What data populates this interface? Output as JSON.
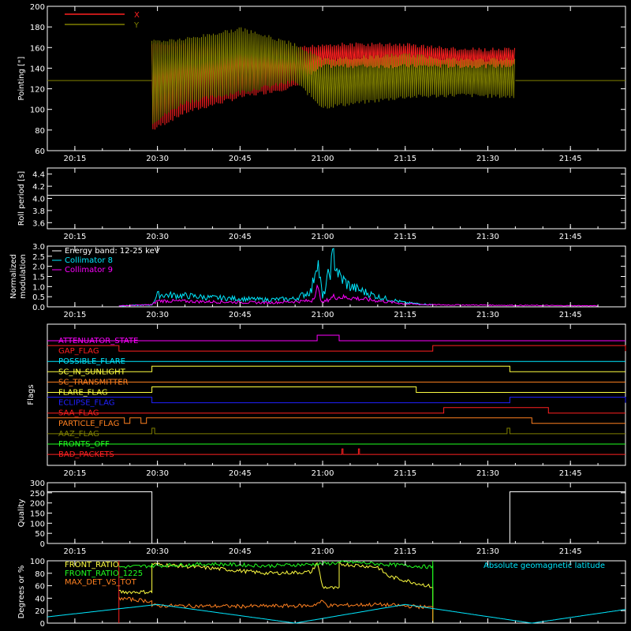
{
  "colors": {
    "background": "#000000",
    "axis": "#ffffff",
    "red": "#ff2020",
    "olive": "#808000",
    "cyan": "#00e8ff",
    "magenta": "#ff00ff",
    "yellow": "#ffff40",
    "green": "#20ff20",
    "orange": "#ff8020",
    "blue": "#2020ff",
    "bright_red": "#ff2020"
  },
  "x_ticks": [
    "20:15",
    "20:30",
    "20:45",
    "21:00",
    "21:15",
    "21:30",
    "21:45"
  ],
  "chart_data": [
    {
      "type": "line",
      "panel": "pointing",
      "title": "",
      "ylabel": "Pointing [\"]",
      "xlim": [
        "20:10",
        "21:55"
      ],
      "ylim": [
        60,
        200
      ],
      "yticks": [
        "60",
        "80",
        "100",
        "120",
        "140",
        "160",
        "180",
        "200"
      ],
      "legend_placement": "top-left",
      "series": [
        {
          "name": "X",
          "color": "#ff2020",
          "envelope": [
            {
              "t": "20:29",
              "low": 78,
              "high": 165
            },
            {
              "t": "20:35",
              "low": 95,
              "high": 165
            },
            {
              "t": "20:45",
              "low": 110,
              "high": 165
            },
            {
              "t": "20:55",
              "low": 120,
              "high": 160
            },
            {
              "t": "21:00",
              "low": 140,
              "high": 165
            },
            {
              "t": "21:15",
              "low": 140,
              "high": 165
            },
            {
              "t": "21:25",
              "low": 140,
              "high": 160
            },
            {
              "t": "21:35",
              "low": 140,
              "high": 160
            }
          ]
        },
        {
          "name": "Y",
          "color": "#808000",
          "baseline": 128,
          "envelope": [
            {
              "t": "20:29",
              "low": 85,
              "high": 168
            },
            {
              "t": "20:35",
              "low": 105,
              "high": 170
            },
            {
              "t": "20:45",
              "low": 115,
              "high": 180
            },
            {
              "t": "20:55",
              "low": 125,
              "high": 165
            },
            {
              "t": "21:00",
              "low": 100,
              "high": 150
            },
            {
              "t": "21:15",
              "low": 110,
              "high": 155
            },
            {
              "t": "21:25",
              "low": 112,
              "high": 150
            },
            {
              "t": "21:35",
              "low": 110,
              "high": 150
            }
          ]
        }
      ]
    },
    {
      "type": "line",
      "panel": "roll",
      "ylabel": "Roll period [s]",
      "xlim": [
        "20:10",
        "21:55"
      ],
      "ylim": [
        3.5,
        4.5
      ],
      "yticks": [
        "3.6",
        "3.8",
        "4.0",
        "4.2",
        "4.4"
      ],
      "series": [
        {
          "color": "#ffffff",
          "value": 4.05
        }
      ]
    },
    {
      "type": "line",
      "panel": "modulation",
      "ylabel": "Normalized modulation",
      "ylabel_lines": [
        "Normalized",
        "modulation"
      ],
      "xlim": [
        "20:10",
        "21:55"
      ],
      "ylim": [
        0,
        3
      ],
      "yticks": [
        "0.0",
        "0.5",
        "1.0",
        "1.5",
        "2.0",
        "2.5",
        "3.0"
      ],
      "legend_placement": "top-left",
      "legend_title": "Energy band: 12-25 keV",
      "series": [
        {
          "name": "Collimator 8",
          "color": "#00e8ff",
          "points": [
            [
              "20:23",
              0.05
            ],
            [
              "20:29",
              0.1
            ],
            [
              "20:30",
              0.6
            ],
            [
              "20:35",
              0.55
            ],
            [
              "20:40",
              0.45
            ],
            [
              "20:45",
              0.4
            ],
            [
              "20:50",
              0.35
            ],
            [
              "20:55",
              0.4
            ],
            [
              "20:58",
              0.8
            ],
            [
              "20:59",
              2.5
            ],
            [
              "21:00",
              0.4
            ],
            [
              "21:02",
              2.5
            ],
            [
              "21:03",
              1.5
            ],
            [
              "21:05",
              1.0
            ],
            [
              "21:10",
              0.5
            ],
            [
              "21:15",
              0.2
            ],
            [
              "21:20",
              0.1
            ]
          ]
        },
        {
          "name": "Collimator 9",
          "color": "#ff00ff",
          "points": [
            [
              "20:23",
              0.05
            ],
            [
              "20:29",
              0.1
            ],
            [
              "20:30",
              0.3
            ],
            [
              "20:40",
              0.25
            ],
            [
              "20:50",
              0.2
            ],
            [
              "20:58",
              0.3
            ],
            [
              "20:59",
              0.9
            ],
            [
              "21:00",
              0.2
            ],
            [
              "21:02",
              0.5
            ],
            [
              "21:05",
              0.45
            ],
            [
              "21:10",
              0.3
            ],
            [
              "21:15",
              0.15
            ],
            [
              "21:20",
              0.1
            ],
            [
              "21:50",
              0.05
            ]
          ]
        }
      ]
    },
    {
      "type": "line",
      "panel": "flags",
      "ylabel": "Flags",
      "xlim": [
        "20:10",
        "21:55"
      ],
      "flags": [
        {
          "name": "ATTENUATOR_STATE",
          "color": "#ff00ff",
          "on": [
            [
              "20:59",
              "21:03"
            ]
          ]
        },
        {
          "name": "GAP_FLAG",
          "color": "#ff2020",
          "on": [
            [
              "20:10",
              "20:23"
            ],
            [
              "21:20",
              "21:55"
            ]
          ]
        },
        {
          "name": "POSSIBLE_FLARE",
          "color": "#00e8ff",
          "on": []
        },
        {
          "name": "SC_IN_SUNLIGHT",
          "color": "#ffff40",
          "on": [
            [
              "20:29",
              "21:34"
            ]
          ]
        },
        {
          "name": "SC_TRANSMITTER",
          "color": "#ff8020",
          "on": []
        },
        {
          "name": "FLARE_FLAG",
          "color": "#ffff40",
          "on": [
            [
              "20:29",
              "21:17"
            ]
          ]
        },
        {
          "name": "ECLIPSE_FLAG",
          "color": "#2020ff",
          "on": [
            [
              "20:10",
              "20:29"
            ],
            [
              "21:34",
              "21:55"
            ]
          ]
        },
        {
          "name": "SAA_FLAG",
          "color": "#ff2020",
          "on": [
            [
              "21:22",
              "21:41"
            ]
          ]
        },
        {
          "name": "PARTICLE_FLAG",
          "color": "#ff8020",
          "on": [
            [
              "20:10",
              "20:24"
            ],
            [
              "20:25",
              "20:27"
            ],
            [
              "20:28",
              "21:38"
            ]
          ]
        },
        {
          "name": "AAZ_FLAG",
          "color": "#808000",
          "on": [
            [
              "20:29",
              "20:29.5"
            ],
            [
              "21:33.5",
              "21:34"
            ]
          ]
        },
        {
          "name": "FRONTS_OFF",
          "color": "#20ff20",
          "on": []
        },
        {
          "name": "BAD_PACKETS",
          "color": "#ff2020",
          "on": [
            [
              "21:03.5",
              "21:03.7"
            ],
            [
              "21:06.5",
              "21:06.7"
            ]
          ]
        }
      ]
    },
    {
      "type": "line",
      "panel": "quality",
      "ylabel": "Quality",
      "xlim": [
        "20:10",
        "21:55"
      ],
      "ylim": [
        0,
        300
      ],
      "yticks": [
        "0",
        "50",
        "100",
        "150",
        "200",
        "250",
        "300"
      ],
      "series": [
        {
          "color": "#ffffff",
          "points": [
            [
              "20:10",
              255
            ],
            [
              "20:29",
              255
            ],
            [
              "20:29",
              0
            ],
            [
              "21:34",
              0
            ],
            [
              "21:34",
              255
            ],
            [
              "21:55",
              255
            ]
          ]
        }
      ]
    },
    {
      "type": "line",
      "panel": "ratios",
      "ylabel": "Degrees or %",
      "xlim": [
        "20:10",
        "21:55"
      ],
      "ylim": [
        0,
        100
      ],
      "yticks": [
        "0",
        "20",
        "40",
        "60",
        "80",
        "100"
      ],
      "annotation": "Absolute geomagnetic latitude",
      "series": [
        {
          "name": "FRONT_RATIO",
          "color": "#ffff40",
          "points": [
            [
              "20:23",
              50
            ],
            [
              "20:29",
              50
            ],
            [
              "20:29",
              95
            ],
            [
              "20:40",
              88
            ],
            [
              "20:50",
              80
            ],
            [
              "20:58",
              82
            ],
            [
              "20:59",
              98
            ],
            [
              "21:00",
              58
            ],
            [
              "21:03",
              55
            ],
            [
              "21:03",
              95
            ],
            [
              "21:10",
              90
            ],
            [
              "21:12",
              75
            ],
            [
              "21:20",
              58
            ],
            [
              "21:20",
              0
            ]
          ]
        },
        {
          "name": "FRONT_RATIO_1225",
          "color": "#20ff20",
          "points": [
            [
              "20:23",
              90
            ],
            [
              "20:29",
              92
            ],
            [
              "20:40",
              95
            ],
            [
              "20:50",
              92
            ],
            [
              "21:00",
              95
            ],
            [
              "21:05",
              98
            ],
            [
              "21:10",
              95
            ],
            [
              "21:20",
              90
            ],
            [
              "21:20",
              0
            ]
          ]
        },
        {
          "name": "MAX_DET_VS_TOT",
          "color": "#ff8020",
          "points": [
            [
              "20:23",
              40
            ],
            [
              "20:29",
              35
            ],
            [
              "20:29",
              28
            ],
            [
              "20:45",
              27
            ],
            [
              "20:58",
              28
            ],
            [
              "21:00",
              35
            ],
            [
              "21:01",
              28
            ],
            [
              "21:10",
              30
            ],
            [
              "21:20",
              25
            ],
            [
              "21:20",
              0
            ]
          ]
        },
        {
          "name": "",
          "color": "#00e8ff",
          "points": [
            [
              "20:10",
              10
            ],
            [
              "20:30",
              30
            ],
            [
              "20:55",
              0
            ],
            [
              "21:15",
              30
            ],
            [
              "21:38",
              0
            ],
            [
              "21:55",
              22
            ]
          ]
        }
      ]
    }
  ]
}
